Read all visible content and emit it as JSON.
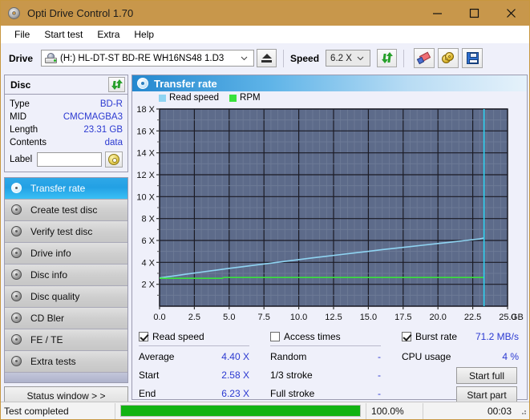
{
  "window": {
    "title": "Opti Drive Control 1.70",
    "icon": "disc-icon",
    "buttons": {
      "minimize": "–",
      "maximize": "□",
      "close": "✕"
    }
  },
  "menu": {
    "items": [
      "File",
      "Start test",
      "Extra",
      "Help"
    ]
  },
  "toolbar": {
    "drive_label": "Drive",
    "drive_value": "(H:)  HL-DT-ST BD-RE  WH16NS48 1.D3",
    "eject_title": "Eject",
    "speed_label": "Speed",
    "speed_value": "6.2 X",
    "refresh_icon": "refresh-icon",
    "erase_icon": "eraser-icon",
    "discs_icon": "gold-discs-icon",
    "save_icon": "save-icon"
  },
  "disc_panel": {
    "title": "Disc",
    "refresh_icon": "refresh-icon",
    "rows": [
      {
        "key": "Type",
        "value": "BD-R"
      },
      {
        "key": "MID",
        "value": "CMCMAGBA3"
      },
      {
        "key": "Length",
        "value": "23.31 GB"
      },
      {
        "key": "Contents",
        "value": "data"
      }
    ],
    "label_key": "Label",
    "label_value": "",
    "label_placeholder": "",
    "label_button_icon": "disc-icon"
  },
  "sidebar": {
    "items": [
      {
        "label": "Transfer rate",
        "active": true
      },
      {
        "label": "Create test disc",
        "active": false
      },
      {
        "label": "Verify test disc",
        "active": false
      },
      {
        "label": "Drive info",
        "active": false
      },
      {
        "label": "Disc info",
        "active": false
      },
      {
        "label": "Disc quality",
        "active": false
      },
      {
        "label": "CD Bler",
        "active": false
      },
      {
        "label": "FE / TE",
        "active": false
      },
      {
        "label": "Extra tests",
        "active": false
      }
    ],
    "status_button": "Status window > >"
  },
  "panel": {
    "title": "Transfer rate",
    "icon": "transfer-rate-icon"
  },
  "chart_data": {
    "type": "line",
    "title": "Transfer rate",
    "xlabel": "GB",
    "ylabel": "X",
    "xlim": [
      0.0,
      25.0
    ],
    "ylim": [
      0,
      18
    ],
    "xticks": [
      "0.0",
      "2.5",
      "5.0",
      "7.5",
      "10.0",
      "12.5",
      "15.0",
      "17.5",
      "20.0",
      "22.5",
      "25.0"
    ],
    "xtick_values": [
      0.0,
      2.5,
      5.0,
      7.5,
      10.0,
      12.5,
      15.0,
      17.5,
      20.0,
      22.5,
      25.0
    ],
    "x_unit": "GB",
    "yticks": [
      "2 X",
      "4 X",
      "6 X",
      "8 X",
      "10 X",
      "12 X",
      "14 X",
      "16 X",
      "18 X"
    ],
    "ytick_values": [
      2,
      4,
      6,
      8,
      10,
      12,
      14,
      16,
      18
    ],
    "grid": true,
    "legend": [
      "Read speed",
      "RPM"
    ],
    "legend_position": "top-left",
    "colors": {
      "read_speed": "#8fd4f2",
      "rpm": "#39e23c",
      "marker": "#2fd2f0",
      "plot_bg": "#5d6b8a"
    },
    "series": [
      {
        "name": "Read speed",
        "color": "#8fd4f2",
        "x": [
          0.0,
          1.0,
          2.0,
          3.0,
          4.0,
          5.0,
          6.0,
          7.0,
          8.0,
          9.0,
          10.0,
          11.0,
          12.0,
          13.0,
          14.0,
          15.0,
          16.0,
          17.0,
          18.0,
          19.0,
          20.0,
          21.0,
          22.0,
          23.0,
          23.31
        ],
        "y": [
          2.58,
          2.76,
          2.94,
          3.11,
          3.28,
          3.45,
          3.61,
          3.77,
          3.93,
          4.09,
          4.25,
          4.41,
          4.56,
          4.71,
          4.86,
          5.01,
          5.16,
          5.3,
          5.44,
          5.58,
          5.72,
          5.86,
          6.0,
          6.14,
          6.23
        ]
      },
      {
        "name": "RPM",
        "color": "#39e23c",
        "x": [
          0.0,
          4.5,
          4.6,
          23.31
        ],
        "y": [
          2.55,
          2.55,
          2.62,
          2.62
        ]
      }
    ],
    "end_marker_x": 23.31
  },
  "stats": {
    "read_speed": {
      "checkbox_label": "Read speed",
      "checked": true,
      "rows": [
        {
          "key": "Average",
          "value": "4.40 X"
        },
        {
          "key": "Start",
          "value": "2.58 X"
        },
        {
          "key": "End",
          "value": "6.23 X"
        }
      ]
    },
    "access_times": {
      "checkbox_label": "Access times",
      "checked": false,
      "rows": [
        {
          "key": "Random",
          "value": "-"
        },
        {
          "key": "1/3 stroke",
          "value": "-"
        },
        {
          "key": "Full stroke",
          "value": "-"
        }
      ]
    },
    "burst": {
      "checkbox_label": "Burst rate",
      "checked": true,
      "value": "71.2 MB/s",
      "cpu_key": "CPU usage",
      "cpu_value": "4 %"
    },
    "buttons": {
      "start_full": "Start full",
      "start_part": "Start part"
    }
  },
  "statusbar": {
    "message": "Test completed",
    "progress_percent": 100.0,
    "progress_text": "100.0%",
    "elapsed": "00:03"
  }
}
